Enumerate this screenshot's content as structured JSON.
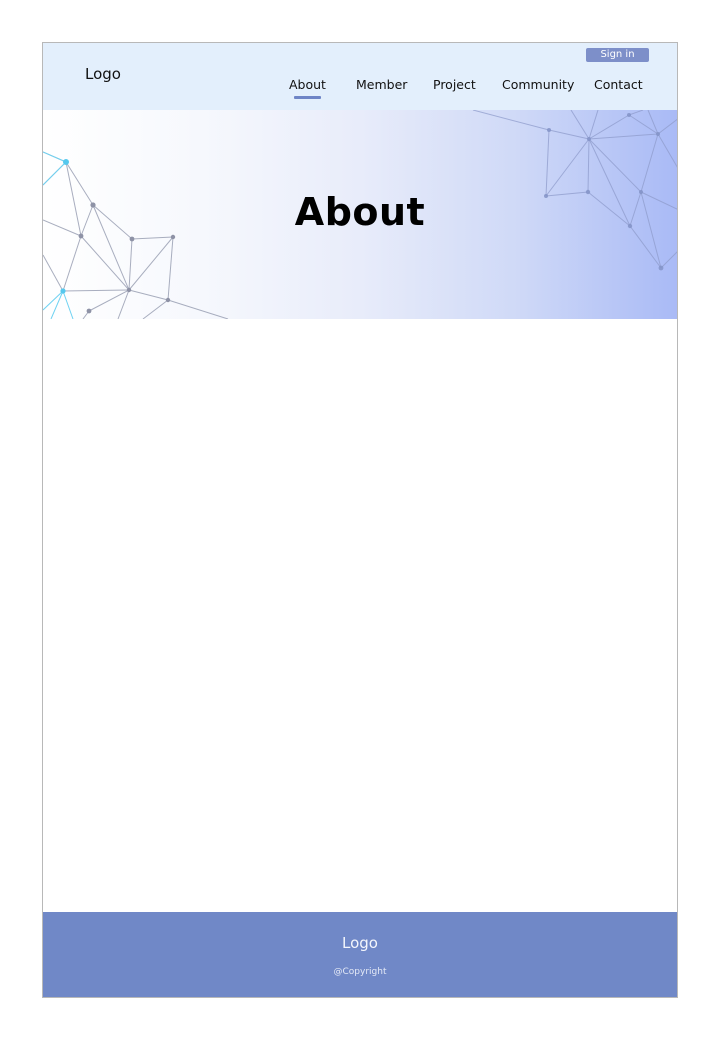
{
  "header": {
    "logo": "Logo",
    "sign_in": "Sign in",
    "nav": {
      "about": "About",
      "member": "Member",
      "project": "Project",
      "community": "Community",
      "contact": "Contact"
    },
    "active_nav": "About"
  },
  "hero": {
    "title": "About"
  },
  "footer": {
    "logo": "Logo",
    "copyright": "@Copyright"
  },
  "colors": {
    "header_bg": "#e3effc",
    "accent": "#7088c7",
    "sign_in_bg": "#7d8fc9",
    "hero_gradient_end": "#a9baf6",
    "network_node_highlight": "#55c8ee"
  },
  "icons": [
    "network-graphic-left",
    "network-graphic-right"
  ]
}
